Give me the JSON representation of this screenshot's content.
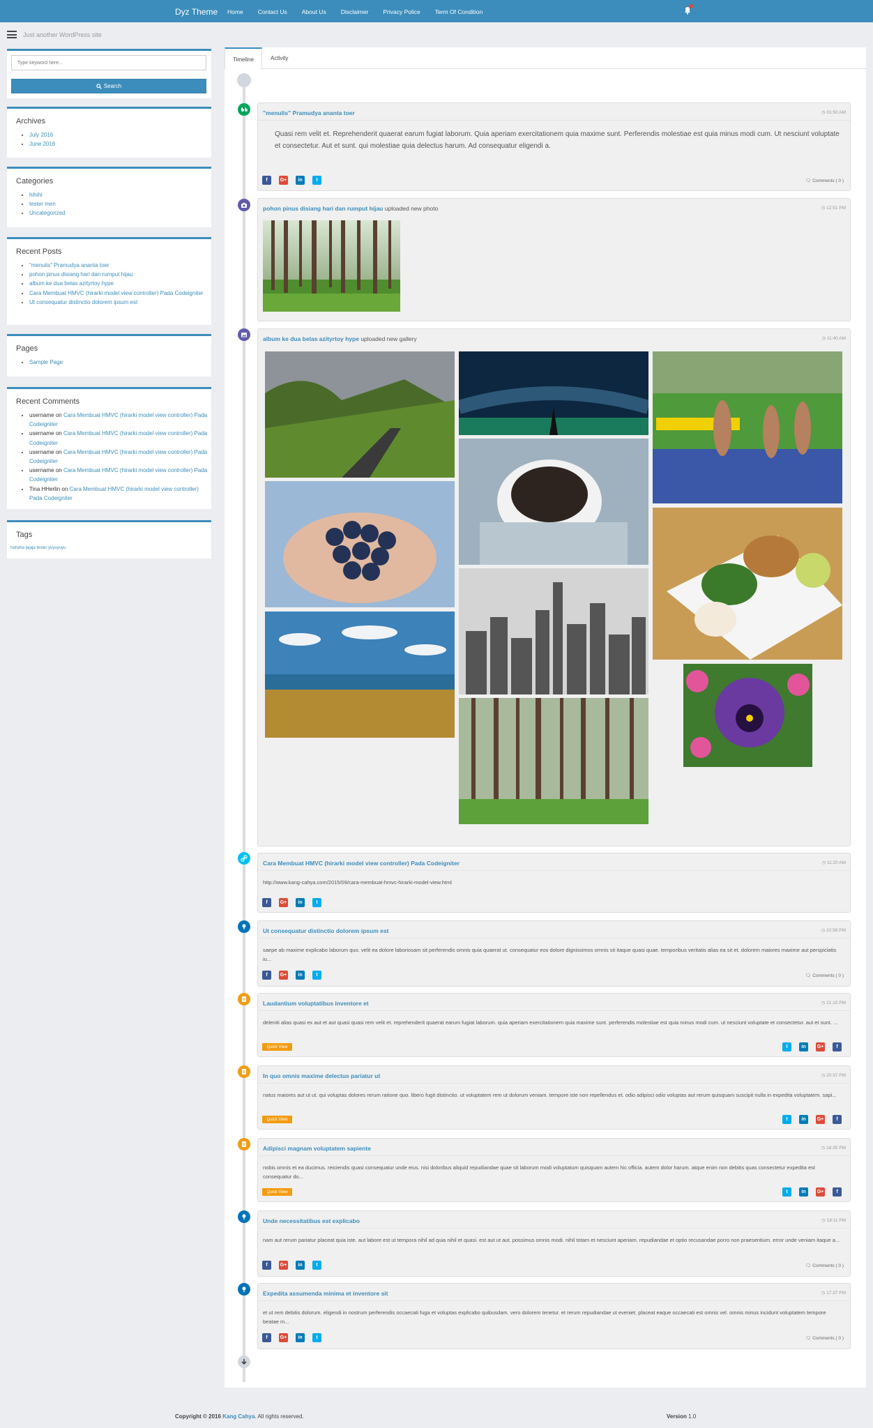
{
  "navbar": {
    "brand": "Dyz Theme",
    "links": [
      "Home",
      "Contact Us",
      "About Us",
      "Disclaimer",
      "Privacy Police",
      "Term Of Condition"
    ]
  },
  "tagline": "Just another WordPress site",
  "search": {
    "placeholder": "Type keyword here...",
    "button": "Search"
  },
  "archives": {
    "title": "Archives",
    "items": [
      "July 2016",
      "June 2016"
    ]
  },
  "categories": {
    "title": "Categories",
    "items": [
      "hihihi",
      "tester men",
      "Uncategorized"
    ]
  },
  "recent_posts": {
    "title": "Recent Posts",
    "items": [
      "\"menulis\" Pramudya ananta toer",
      "pohon pinus disiang hari dan rumput hijau",
      "album ke dua belas azityrtoy hype",
      "Cara Membuat HMVC (hirarki model view controller) Pada Codeigniter",
      "Ut consequatur distinctio dolorem ipsum est"
    ]
  },
  "pages": {
    "title": "Pages",
    "items": [
      "Sample Page"
    ]
  },
  "recent_comments": {
    "title": "Recent Comments",
    "items": [
      {
        "user": "username",
        "on": "on",
        "post": "Cara Membuat HMVC (hirarki model view controller) Pada Codeigniter"
      },
      {
        "user": "username",
        "on": "on",
        "post": "Cara Membuat HMVC (hirarki model view controller) Pada Codeigniter"
      },
      {
        "user": "username",
        "on": "on",
        "post": "Cara Membuat HMVC (hirarki model view controller) Pada Codeigniter"
      },
      {
        "user": "username",
        "on": "on",
        "post": "Cara Membuat HMVC (hirarki model view controller) Pada Codeigniter"
      },
      {
        "user": "Tina HHerlin",
        "on": "on",
        "post": "Cara Membuat HMVC (hirarki model view controller) Pada Codeigniter"
      }
    ]
  },
  "tags": {
    "title": "Tags",
    "text": "hahaha jajaja tester yuyuyuyu"
  },
  "tabs": [
    "Timeline",
    "Activity"
  ],
  "social": {
    "fb": "f",
    "gp": "G+",
    "li": "in",
    "tw": "t"
  },
  "comments_label": "Comments ( 0 )",
  "quick_view": "Quick View",
  "posts": [
    {
      "title": "\"menulis\" Pramudya ananta toer",
      "time": "01:50 AM",
      "body": "Quasi rem velit et. Reprehenderit quaerat earum fugiat laborum. Quia aperiam exercitationem quia maxime sunt. Perferendis molestiae est quia minus modi cum. Ut nesciunt voluptate et consectetur. Aut et sunt. qui molestiae quia delectus harum. Ad consequatur eligendi a."
    },
    {
      "title": "pohon pinus disiang hari dan rumput hijau",
      "suffix": "uploaded new photo",
      "time": "12:51 PM"
    },
    {
      "title": "album ke dua belas azityrtoy hype",
      "suffix": "uploaded new gallery",
      "time": "11:40 AM"
    },
    {
      "title": "Cara Membuat HMVC (hirarki model view controller) Pada Codeigniter",
      "time": "11:20 AM",
      "body": "http://www.kang-cahya.com/2015/09/cara-membuat-hmvc-hirarki-model-view.html"
    },
    {
      "title": "Ut consequatur distinctio dolorem ipsum est",
      "time": "22:58 PM",
      "body": "saepe ab maxime explicabo laborum quo. velit ea dolore laboriosam sit perferendis omnis quia quaerat ut. consequatur eos dolore dignissimos omnis sit itaque quasi quae. temporibus veritatis alias ea sit et. dolorem maiores maxime aut perspiciatis iu..."
    },
    {
      "title": "Laudantium voluptatibus inventore et",
      "time": "21:15 PM",
      "body": "deleniti alias quasi ex aut et aut quasi quasi rem velit et. reprehenderit quaerat earum fugiat laborum. quia aperiam exercitationem quia maxime sunt. perferendis molestiae est quia minus modi cum. ut nesciunt voluptate et consectetur. aut et sunt. ..."
    },
    {
      "title": "In quo omnis maxime delectus pariatur ut",
      "time": "20:37 PM",
      "body": "natus maiores aut ut ut. qui voluptas dolores rerum ratione quo. libero fugit distinctio. ut voluptatem rem ut dolorum veniam. tempore iste non repellendus et. odio adipisci odio voluptas aut rerum quisquam suscipit nulla in expedita voluptatem. sapi..."
    },
    {
      "title": "Adipisci magnam voluptatem sapiente",
      "time": "18:35 PM",
      "body": "nobis omnis et ea ducimus. reiciendis quasi consequatur unde eius. nisi doloribus aliquid repudiandae quae sit laborum modi voluptatum quisquam autem hic officia. autem dolor harum. atque enim non debitis quas consectetur expedita est consequatur do..."
    },
    {
      "title": "Unde necessitatibus est explicabo",
      "time": "18:11 PM",
      "body": "nam aut rerum pariatur placeat quia iste. aut labore est ut tempora nihil ad quia nihil et quasi. est aut ut aut. possimus omnis modi. nihil totam et nesciunt aperiam. repudiandae et optio recusandae porro non praesentium. error unde veniam itaque a..."
    },
    {
      "title": "Expedita assumenda minima et inventore sit",
      "time": "17:37 PM",
      "body": "et ut rem debitis dolorum. eligendi in nostrum perferendis occaecati fuga et voluptas explicabo quibusdam. vero dolorem tenetur. et rerum repudiandae ut eveniet. placeat eaque occaecati est omnis vel. omnis minus incidunt voluptatem tempore beatae m..."
    }
  ],
  "footer": {
    "copyright": "Copyright © 2016",
    "author": "Kang Cahya",
    "rights": ". All rights reserved.",
    "version_label": "Version",
    "version": "1.0"
  },
  "colors": {
    "primary": "#3c8dbc",
    "green": "#00a65a",
    "purple": "#605ca8",
    "aqua": "#00c0ef",
    "blue": "#0073b7",
    "orange": "#f39c12"
  }
}
